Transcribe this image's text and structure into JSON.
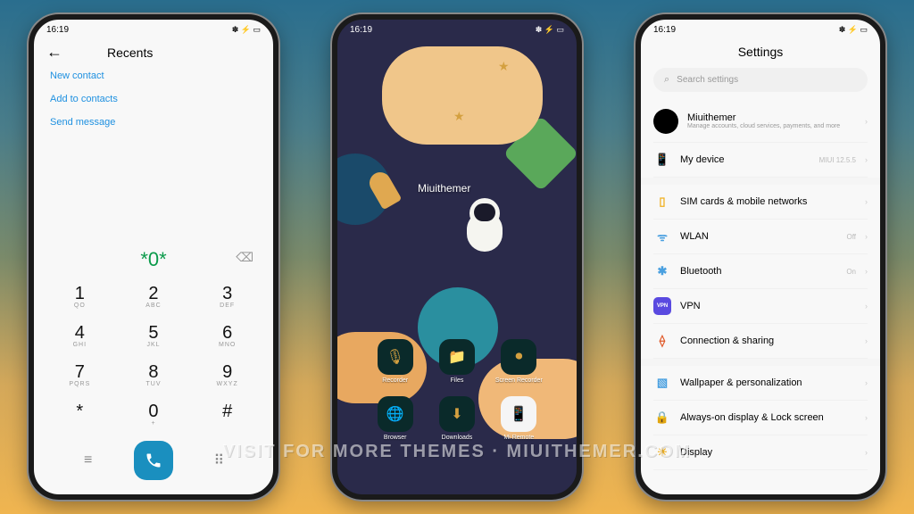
{
  "status": {
    "time": "16:19",
    "icons": "✽ ⚡ ▭"
  },
  "phone1": {
    "title": "Recents",
    "menu": [
      "New contact",
      "Add to contacts",
      "Send message"
    ],
    "dialed": "*0*",
    "keys": [
      {
        "n": "1",
        "l": "QO"
      },
      {
        "n": "2",
        "l": "ABC"
      },
      {
        "n": "3",
        "l": "DEF"
      },
      {
        "n": "4",
        "l": "GHI"
      },
      {
        "n": "5",
        "l": "JKL"
      },
      {
        "n": "6",
        "l": "MNO"
      },
      {
        "n": "7",
        "l": "PQRS"
      },
      {
        "n": "8",
        "l": "TUV"
      },
      {
        "n": "9",
        "l": "WXYZ"
      },
      {
        "n": "*",
        "l": ""
      },
      {
        "n": "0",
        "l": "+"
      },
      {
        "n": "#",
        "l": ""
      }
    ]
  },
  "phone2": {
    "watermark": "Miuithemer",
    "apps": [
      {
        "label": "Recorder",
        "icon": "🎙"
      },
      {
        "label": "Files",
        "icon": "📁"
      },
      {
        "label": "Screen Recorder",
        "icon": "⏺"
      },
      {
        "label": "Browser",
        "icon": "🌐"
      },
      {
        "label": "Downloads",
        "icon": "⬇"
      },
      {
        "label": "Mi Remote",
        "icon": "📱"
      }
    ]
  },
  "phone3": {
    "title": "Settings",
    "search_placeholder": "Search settings",
    "account": {
      "name": "Miuithemer",
      "sub": "Manage accounts, cloud services, payments, and more"
    },
    "items": [
      {
        "icon": "📱",
        "color": "#4aa0e0",
        "label": "My device",
        "value": "MIUI 12.5.5"
      },
      {
        "gap": true
      },
      {
        "icon": "▯",
        "color": "#f0b020",
        "label": "SIM cards & mobile networks"
      },
      {
        "icon": "ᯤ",
        "color": "#4aa0e0",
        "label": "WLAN",
        "value": "Off"
      },
      {
        "icon": "✱",
        "color": "#4aa0e0",
        "label": "Bluetooth",
        "value": "On"
      },
      {
        "icon": "VPN",
        "color": "#5a4ae0",
        "label": "VPN"
      },
      {
        "icon": "⟠",
        "color": "#e05a2a",
        "label": "Connection & sharing"
      },
      {
        "gap": true
      },
      {
        "icon": "▧",
        "color": "#4aa0e0",
        "label": "Wallpaper & personalization"
      },
      {
        "icon": "🔒",
        "color": "#e04040",
        "label": "Always-on display & Lock screen"
      },
      {
        "icon": "☀",
        "color": "#f0b020",
        "label": "Display"
      }
    ]
  },
  "footer": "VISIT FOR MORE THEMES · MIUITHEMER.COM"
}
